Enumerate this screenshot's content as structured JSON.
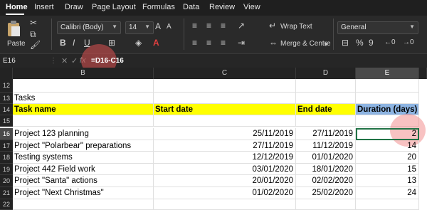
{
  "tabs": [
    "Home",
    "Insert",
    "Draw",
    "Page Layout",
    "Formulas",
    "Data",
    "Review",
    "View"
  ],
  "ribbon": {
    "paste": "Paste",
    "font_name": "Calibri (Body)",
    "font_size": "14",
    "wrap_text": "Wrap Text",
    "merge_centre": "Merge & Centre",
    "number_format": "General",
    "bold": "B",
    "italic": "I",
    "underline": "U",
    "percent": "%",
    "comma": "9"
  },
  "formula_bar": {
    "cell_ref": "E16",
    "fx": "fx",
    "formula": "=D16-C16"
  },
  "columns": [
    "B",
    "C",
    "D",
    "E"
  ],
  "rows": [
    {
      "num": "12",
      "b": "",
      "c": "",
      "d": "",
      "e": ""
    },
    {
      "num": "13",
      "b": "Tasks",
      "c": "",
      "d": "",
      "e": ""
    },
    {
      "num": "14",
      "b": "Task name",
      "c": "Start date",
      "d": "End date",
      "e": "Duration (days)"
    },
    {
      "num": "15",
      "b": "",
      "c": "",
      "d": "",
      "e": ""
    },
    {
      "num": "16",
      "b": "Project 123 planning",
      "c": "25/11/2019",
      "d": "27/11/2019",
      "e": "2"
    },
    {
      "num": "17",
      "b": "Project \"Polarbear\" preparations",
      "c": "27/11/2019",
      "d": "11/12/2019",
      "e": "14"
    },
    {
      "num": "18",
      "b": "Testing systems",
      "c": "12/12/2019",
      "d": "01/01/2020",
      "e": "20"
    },
    {
      "num": "19",
      "b": "Project 442 Field work",
      "c": "03/01/2020",
      "d": "18/01/2020",
      "e": "15"
    },
    {
      "num": "20",
      "b": "Project \"Santa\" actions",
      "c": "20/01/2020",
      "d": "02/02/2020",
      "e": "13"
    },
    {
      "num": "21",
      "b": "Project \"Next Christmas\"",
      "c": "01/02/2020",
      "d": "25/02/2020",
      "e": "24"
    },
    {
      "num": "22",
      "b": "",
      "c": "",
      "d": "",
      "e": ""
    }
  ]
}
